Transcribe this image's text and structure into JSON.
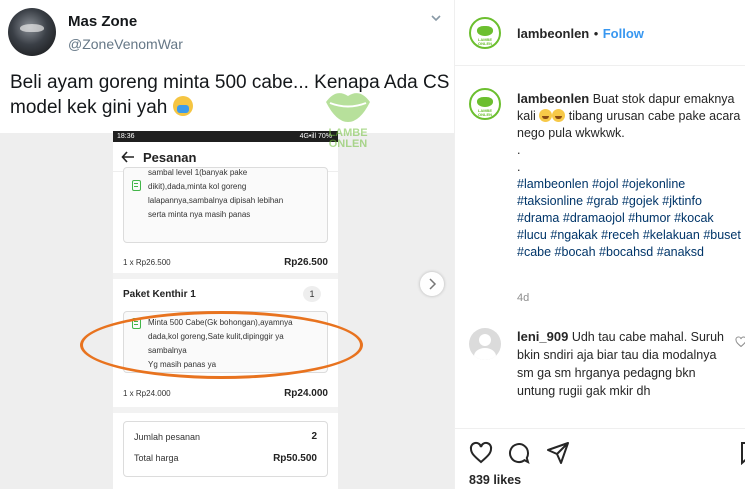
{
  "tweet": {
    "display_name": "Mas Zone",
    "handle": "@ZoneVenomWar",
    "text": "Beli ayam goreng minta 500 cabe... Kenapa Ada CS model kek gini yah"
  },
  "watermark": {
    "line1": "LAMBE",
    "line2": "ONLEN"
  },
  "order_screen": {
    "status_time": "18:36",
    "status_right": "4G•ill 70%",
    "title": "Pesanan",
    "note1_lines": [
      "sambal level 1(banyak pake",
      "dikit),dada,minta kol goreng",
      "lalapannya,sambalnya dipisah lebihan",
      "serta minta nya masih panas"
    ],
    "item1_qty_price": "1 x Rp26.500",
    "item1_total": "Rp26.500",
    "item2_title": "Paket Kenthir 1",
    "item2_badge": "1",
    "note2_lines": [
      "Minta 500 Cabe(Gk bohongan),ayamnya",
      "dada,kol goreng,Sate kulit,dipinggir ya",
      "sambalnya",
      "Yg masih panas ya"
    ],
    "item2_qty_price": "1 x Rp24.000",
    "item2_total": "Rp24.000",
    "summary_qty_label": "Jumlah pesanan",
    "summary_qty_value": "2",
    "summary_total_label": "Total harga",
    "summary_total_value": "Rp50.500"
  },
  "ig": {
    "username": "lambeonlen",
    "dot": "•",
    "follow_label": "Follow",
    "avatar_caption": "LAMBE ONLEN",
    "caption_user": "lambeonlen",
    "caption_text_1": "Buat stok dapur emaknya kali",
    "caption_text_2": "tibang urusan cabe pake acara nego pula wkwkwk.",
    "caption_dot_1": ".",
    "caption_dot_2": ".",
    "hashtags": [
      "#lambeonlen",
      "#ojol",
      "#ojekonline",
      "#taksionline",
      "#grab",
      "#gojek",
      "#jktinfo",
      "#drama",
      "#dramaojol",
      "#humor",
      "#kocak",
      "#lucu",
      "#ngakak",
      "#receh",
      "#kelakuan",
      "#buset",
      "#cabe",
      "#bocah",
      "#bocahsd",
      "#anaksd"
    ],
    "time_ago": "4d",
    "comment_user": "leni_909",
    "comment_text": "Udh tau cabe mahal. Suruh bkin sndiri aja biar tau dia modalnya sm ga sm hrganya pedagng bkn untung rugii gak mkir dh",
    "likes": "839 likes"
  }
}
